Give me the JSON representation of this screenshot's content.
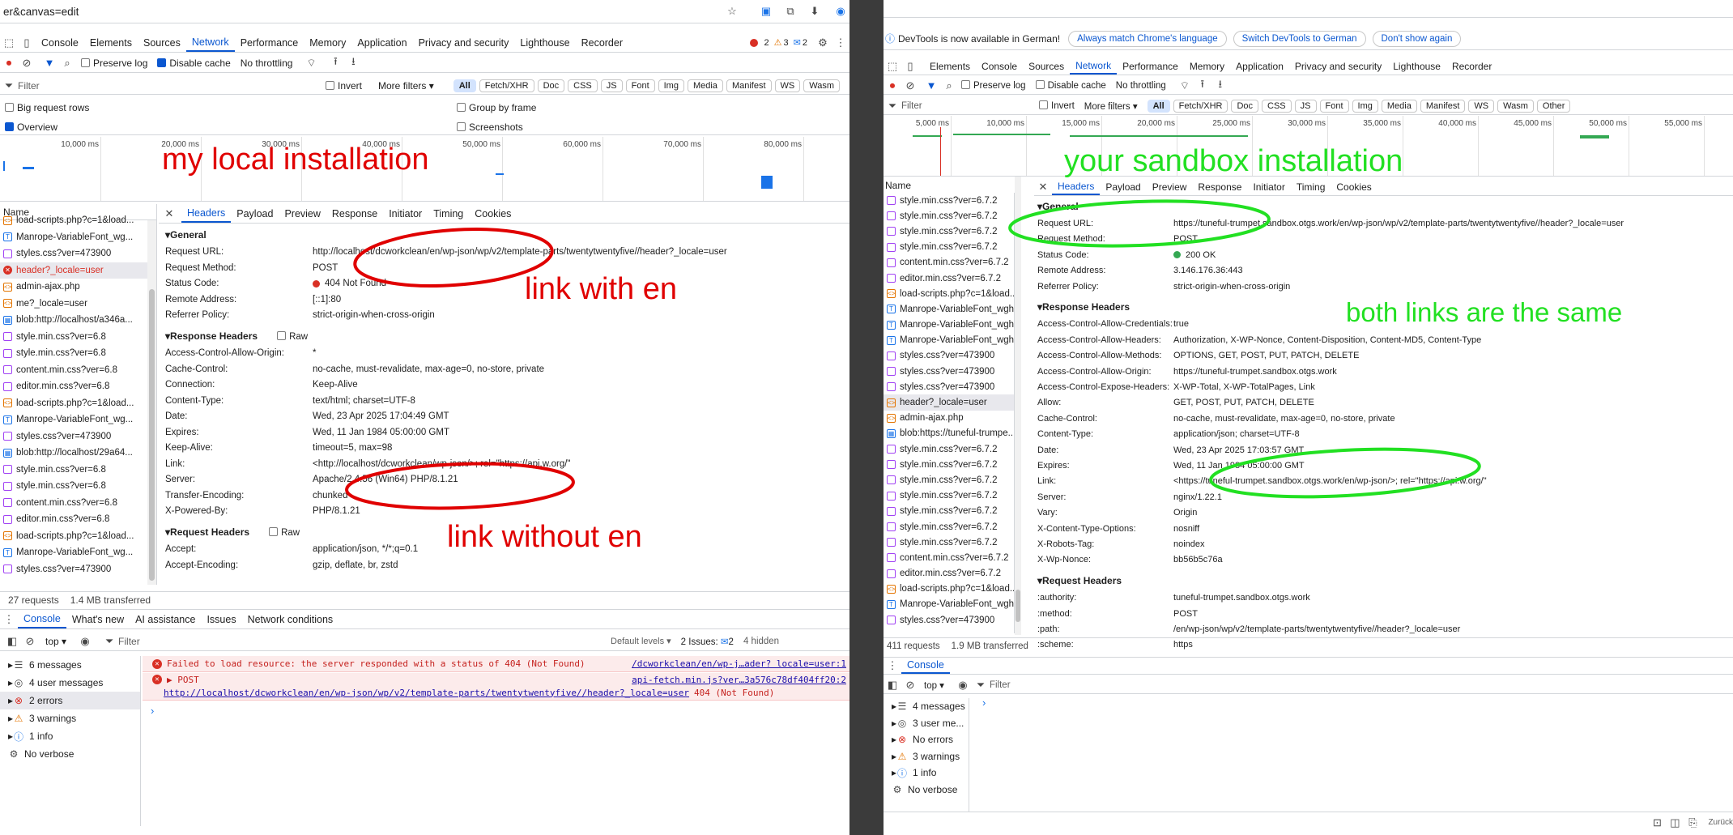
{
  "left": {
    "address": "er&canvas=edit",
    "tabs": [
      "Console",
      "Elements",
      "Sources",
      "Network",
      "Performance",
      "Memory",
      "Application",
      "Privacy and security",
      "Lighthouse",
      "Recorder"
    ],
    "selected_tab": "Network",
    "badges": {
      "errors": "2",
      "warnings": "3",
      "info": "2"
    },
    "toolbar": {
      "preserve_log": "Preserve log",
      "disable_cache": "Disable cache",
      "throttling": "No throttling"
    },
    "filter": {
      "placeholder": "Filter",
      "invert": "Invert",
      "more_filters": "More filters ▾",
      "types": [
        "All",
        "Fetch/XHR",
        "Doc",
        "CSS",
        "JS",
        "Font",
        "Img",
        "Media",
        "Manifest",
        "WS",
        "Wasm"
      ]
    },
    "options": {
      "big_rows": "Big request rows",
      "group_by_frame": "Group by frame",
      "overview": "Overview",
      "screenshots": "Screenshots"
    },
    "timeline": [
      "10,000 ms",
      "20,000 ms",
      "30,000 ms",
      "40,000 ms",
      "50,000 ms",
      "60,000 ms",
      "70,000 ms",
      "80,000 ms"
    ],
    "name_header": "Name",
    "requests": [
      "load-scripts.php?c=1&load...",
      "Manrope-VariableFont_wg...",
      "styles.css?ver=473900",
      "header?_locale=user",
      "admin-ajax.php",
      "me?_locale=user",
      "blob:http://localhost/a346a...",
      "style.min.css?ver=6.8",
      "style.min.css?ver=6.8",
      "content.min.css?ver=6.8",
      "editor.min.css?ver=6.8",
      "load-scripts.php?c=1&load...",
      "Manrope-VariableFont_wg...",
      "styles.css?ver=473900",
      "blob:http://localhost/29a64...",
      "style.min.css?ver=6.8",
      "style.min.css?ver=6.8",
      "content.min.css?ver=6.8",
      "editor.min.css?ver=6.8",
      "load-scripts.php?c=1&load...",
      "Manrope-VariableFont_wg...",
      "styles.css?ver=473900"
    ],
    "detail_tabs": [
      "Headers",
      "Payload",
      "Preview",
      "Response",
      "Initiator",
      "Timing",
      "Cookies"
    ],
    "general_title": "General",
    "general": [
      {
        "k": "Request URL:",
        "v": "http://localhost/dcworkclean/en/wp-json/wp/v2/template-parts/twentytwentyfive//header?_locale=user"
      },
      {
        "k": "Request Method:",
        "v": "POST"
      },
      {
        "k": "Status Code:",
        "v": "404 Not Found"
      },
      {
        "k": "Remote Address:",
        "v": "[::1]:80"
      },
      {
        "k": "Referrer Policy:",
        "v": "strict-origin-when-cross-origin"
      }
    ],
    "response_title": "Response Headers",
    "raw": "Raw",
    "response": [
      {
        "k": "Access-Control-Allow-Origin:",
        "v": "*"
      },
      {
        "k": "Cache-Control:",
        "v": "no-cache, must-revalidate, max-age=0, no-store, private"
      },
      {
        "k": "Connection:",
        "v": "Keep-Alive"
      },
      {
        "k": "Content-Type:",
        "v": "text/html; charset=UTF-8"
      },
      {
        "k": "Date:",
        "v": "Wed, 23 Apr 2025 17:04:49 GMT"
      },
      {
        "k": "Expires:",
        "v": "Wed, 11 Jan 1984 05:00:00 GMT"
      },
      {
        "k": "Keep-Alive:",
        "v": "timeout=5, max=98"
      },
      {
        "k": "Link:",
        "v": "<http://localhost/dcworkclean/wp-json/>; rel=\"https://api.w.org/\""
      },
      {
        "k": "Server:",
        "v": "Apache/2.4.56 (Win64) PHP/8.1.21"
      },
      {
        "k": "Transfer-Encoding:",
        "v": "chunked"
      },
      {
        "k": "X-Powered-By:",
        "v": "PHP/8.1.21"
      }
    ],
    "request_title": "Request Headers",
    "request": [
      {
        "k": "Accept:",
        "v": "application/json, */*;q=0.1"
      },
      {
        "k": "Accept-Encoding:",
        "v": "gzip, deflate, br, zstd"
      }
    ],
    "status": {
      "requests": "27 requests",
      "transferred": "1.4 MB transferred"
    },
    "drawer_tabs": [
      "Console",
      "What's new",
      "AI assistance",
      "Issues",
      "Network conditions"
    ],
    "console_toolbar": {
      "context": "top ▾",
      "filter": "Filter",
      "levels": "Default levels ▾",
      "issues": "2 Issues:",
      "issues_count": "2",
      "hidden": "4 hidden"
    },
    "console_sidebar": [
      "6 messages",
      "4 user messages",
      "2 errors",
      "3 warnings",
      "1 info",
      "No verbose"
    ],
    "console_msgs": {
      "m1": "Failed to load resource: the server responded with a status of 404 (Not Found)",
      "m1_src": "/dcworkclean/en/wp-j…ader? locale=user:1",
      "m2_head": "▶ POST",
      "m2_src": "api-fetch.min.js?ver…3a576c78df404ff20:2",
      "m2_url": "http://localhost/dcworkclean/en/wp-json/wp/v2/template-parts/twentytwentyfive//header?_locale=user",
      "m2_tail": "404 (Not Found)"
    },
    "annotations": {
      "title": "my local installation",
      "a1": "link with en",
      "a2": "link without en"
    }
  },
  "right": {
    "notice": "DevTools is now available in German!",
    "notice_buttons": [
      "Always match Chrome's language",
      "Switch DevTools to German",
      "Don't show again"
    ],
    "tabs": [
      "Elements",
      "Console",
      "Sources",
      "Network",
      "Performance",
      "Memory",
      "Application",
      "Privacy and security",
      "Lighthouse",
      "Recorder"
    ],
    "selected_tab": "Network",
    "toolbar": {
      "preserve_log": "Preserve log",
      "disable_cache": "Disable cache",
      "throttling": "No throttling"
    },
    "filter": {
      "placeholder": "Filter",
      "invert": "Invert",
      "more_filters": "More filters ▾",
      "types": [
        "All",
        "Fetch/XHR",
        "Doc",
        "CSS",
        "JS",
        "Font",
        "Img",
        "Media",
        "Manifest",
        "WS",
        "Wasm",
        "Other"
      ]
    },
    "timeline": [
      "5,000 ms",
      "10,000 ms",
      "15,000 ms",
      "20,000 ms",
      "25,000 ms",
      "30,000 ms",
      "35,000 ms",
      "40,000 ms",
      "45,000 ms",
      "50,000 ms",
      "55,000 ms"
    ],
    "name_header": "Name",
    "requests": [
      "style.min.css?ver=6.7.2",
      "style.min.css?ver=6.7.2",
      "style.min.css?ver=6.7.2",
      "style.min.css?ver=6.7.2",
      "content.min.css?ver=6.7.2",
      "editor.min.css?ver=6.7.2",
      "load-scripts.php?c=1&load...",
      "Manrope-VariableFont_wgh...",
      "Manrope-VariableFont_wgh...",
      "Manrope-VariableFont_wgh...",
      "styles.css?ver=473900",
      "styles.css?ver=473900",
      "styles.css?ver=473900",
      "header?_locale=user",
      "admin-ajax.php",
      "blob:https://tuneful-trumpe...",
      "style.min.css?ver=6.7.2",
      "style.min.css?ver=6.7.2",
      "style.min.css?ver=6.7.2",
      "style.min.css?ver=6.7.2",
      "style.min.css?ver=6.7.2",
      "style.min.css?ver=6.7.2",
      "style.min.css?ver=6.7.2",
      "content.min.css?ver=6.7.2",
      "editor.min.css?ver=6.7.2",
      "load-scripts.php?c=1&load...",
      "Manrope-VariableFont_wgh...",
      "styles.css?ver=473900"
    ],
    "detail_tabs": [
      "Headers",
      "Payload",
      "Preview",
      "Response",
      "Initiator",
      "Timing",
      "Cookies"
    ],
    "general_title": "General",
    "general": [
      {
        "k": "Request URL:",
        "v": "https://tuneful-trumpet.sandbox.otgs.work/en/wp-json/wp/v2/template-parts/twentytwentyfive//header?_locale=user"
      },
      {
        "k": "Request Method:",
        "v": "POST"
      },
      {
        "k": "Status Code:",
        "v": "200 OK"
      },
      {
        "k": "Remote Address:",
        "v": "3.146.176.36:443"
      },
      {
        "k": "Referrer Policy:",
        "v": "strict-origin-when-cross-origin"
      }
    ],
    "response_title": "Response Headers",
    "response": [
      {
        "k": "Access-Control-Allow-Credentials:",
        "v": "true"
      },
      {
        "k": "Access-Control-Allow-Headers:",
        "v": "Authorization, X-WP-Nonce, Content-Disposition, Content-MD5, Content-Type"
      },
      {
        "k": "Access-Control-Allow-Methods:",
        "v": "OPTIONS, GET, POST, PUT, PATCH, DELETE"
      },
      {
        "k": "Access-Control-Allow-Origin:",
        "v": "https://tuneful-trumpet.sandbox.otgs.work"
      },
      {
        "k": "Access-Control-Expose-Headers:",
        "v": "X-WP-Total, X-WP-TotalPages, Link"
      },
      {
        "k": "Allow:",
        "v": "GET, POST, PUT, PATCH, DELETE"
      },
      {
        "k": "Cache-Control:",
        "v": "no-cache, must-revalidate, max-age=0, no-store, private"
      },
      {
        "k": "Content-Type:",
        "v": "application/json; charset=UTF-8"
      },
      {
        "k": "Date:",
        "v": "Wed, 23 Apr 2025 17:03:57 GMT"
      },
      {
        "k": "Expires:",
        "v": "Wed, 11 Jan 1984 05:00:00 GMT"
      },
      {
        "k": "Link:",
        "v": "<https://tuneful-trumpet.sandbox.otgs.work/en/wp-json/>; rel=\"https://api.w.org/\""
      },
      {
        "k": "Server:",
        "v": "nginx/1.22.1"
      },
      {
        "k": "Vary:",
        "v": "Origin"
      },
      {
        "k": "X-Content-Type-Options:",
        "v": "nosniff"
      },
      {
        "k": "X-Robots-Tag:",
        "v": "noindex"
      },
      {
        "k": "X-Wp-Nonce:",
        "v": "bb56b5c76a"
      }
    ],
    "request_title": "Request Headers",
    "request": [
      {
        "k": ":authority:",
        "v": "tuneful-trumpet.sandbox.otgs.work"
      },
      {
        "k": ":method:",
        "v": "POST"
      },
      {
        "k": ":path:",
        "v": "/en/wp-json/wp/v2/template-parts/twentytwentyfive//header?_locale=user"
      },
      {
        "k": ":scheme:",
        "v": "https"
      }
    ],
    "status": {
      "requests": "411 requests",
      "transferred": "1.9 MB transferred"
    },
    "drawer_tab": "Console",
    "console_toolbar": {
      "context": "top ▾",
      "filter": "Filter"
    },
    "console_sidebar": [
      "4 messages",
      "3 user me...",
      "No errors",
      "3 warnings",
      "1 info",
      "No verbose"
    ],
    "bottom_text": "Zurück",
    "annotations": {
      "title": "your sandbox installation",
      "a1": "both links are the same"
    }
  },
  "colors": {
    "accent": "#0b57d0",
    "red_anno": "#e00000",
    "green_anno": "#22e022",
    "error": "#d93025",
    "warning": "#e37400"
  }
}
